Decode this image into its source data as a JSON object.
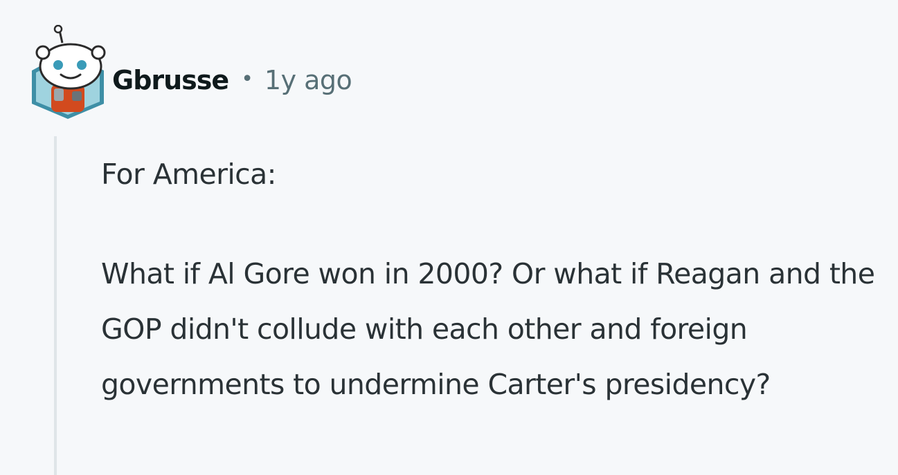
{
  "comment": {
    "author": "Gbrusse",
    "separator": "•",
    "timestamp": "1y ago",
    "avatar_icon": "snoo-avatar-icon",
    "paragraphs": [
      "For America:",
      "What if Al Gore won in 2000? Or what if Reagan and the GOP didn't collude with each other and foreign governments to undermine Carter's presidency?"
    ]
  },
  "colors": {
    "background": "#f6f8fa",
    "username": "#0f1a1c",
    "meta": "#576f76",
    "body_text": "#2a3236",
    "thread_line": "#dfe5e8",
    "avatar_hex": "#5fb0c4"
  }
}
